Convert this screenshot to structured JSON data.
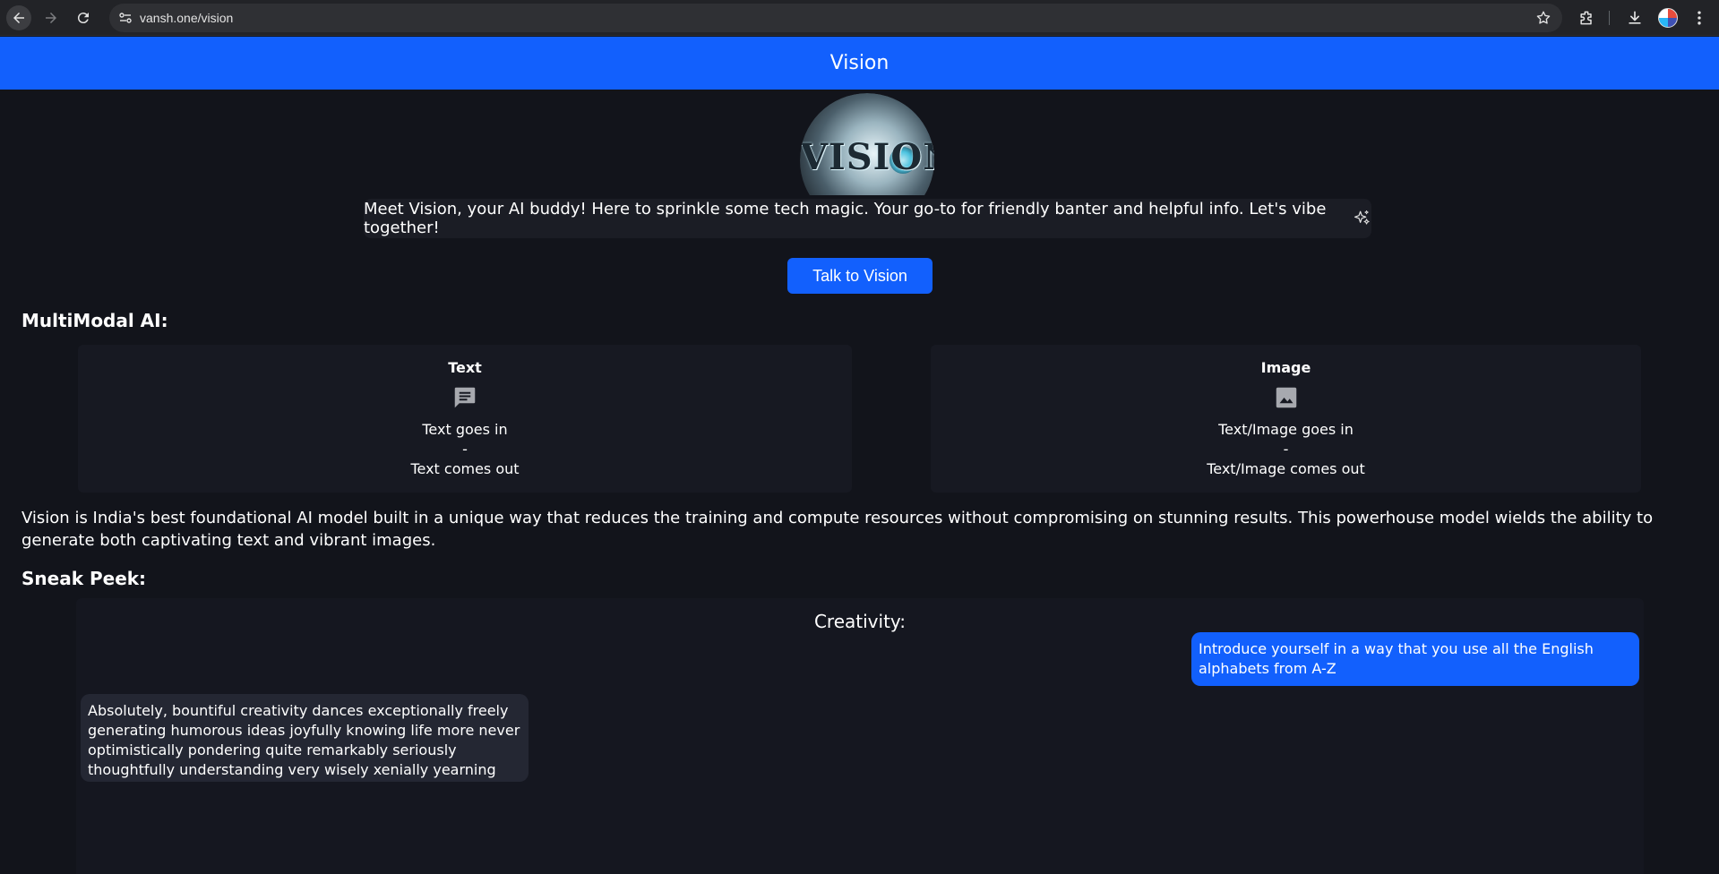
{
  "browser": {
    "url": "vansh.one/vision",
    "icons": [
      "back-arrow-icon",
      "forward-arrow-icon",
      "reload-icon",
      "site-info-icon",
      "star-icon",
      "extensions-icon",
      "download-icon",
      "profile-avatar",
      "kebab-menu-icon"
    ]
  },
  "header": {
    "title": "Vision",
    "color": "#1260fd"
  },
  "hero": {
    "avatar_text": "VISION",
    "intro": "Meet Vision, your AI buddy! Here to sprinkle some tech magic. Your go-to for friendly banter and helpful info. Let's vibe together!",
    "cta_label": "Talk to Vision"
  },
  "multimodal": {
    "heading": "MultiModal AI:",
    "cards": [
      {
        "title": "Text",
        "icon": "chat-message-icon",
        "in": "Text goes in",
        "sep": "-",
        "out": "Text comes out"
      },
      {
        "title": "Image",
        "icon": "image-icon",
        "in": "Text/Image goes in",
        "sep": "-",
        "out": "Text/Image comes out"
      }
    ]
  },
  "description": "Vision is India's best foundational AI model built in a unique way that reduces the training and compute resources without compromising on stunning results. This powerhouse model wields the ability to generate both captivating text and vibrant images.",
  "sneak_peek": {
    "heading": "Sneak Peek:",
    "section_title": "Creativity:",
    "user_message": "Introduce yourself in a way that you use all the English alphabets from A-Z",
    "bot_message": "Absolutely, bountiful creativity dances exceptionally freely generating humorous ideas joyfully knowing life more never optimistically pondering quite remarkably seriously thoughtfully understanding very wisely xenially yearning zealously."
  }
}
